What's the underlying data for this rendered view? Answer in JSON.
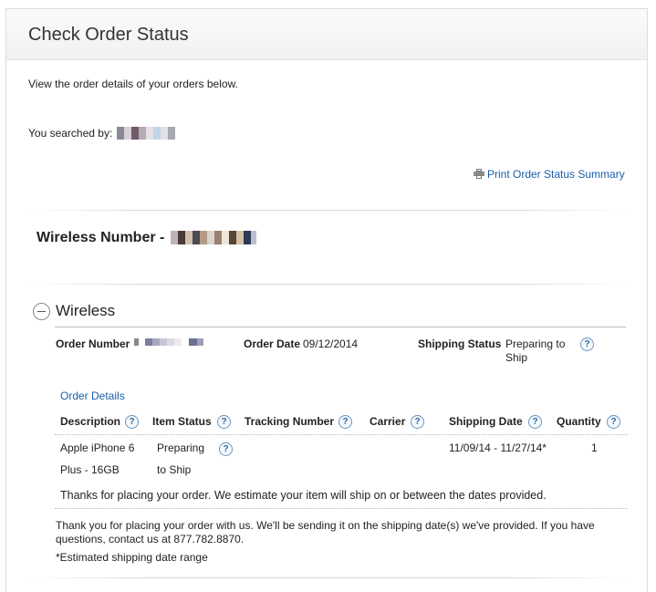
{
  "page": {
    "title": "Check Order Status",
    "intro": "View the order details of your orders below.",
    "searched_by_label": "You searched by:",
    "print_link": "Print Order Status Summary"
  },
  "wireless_number": {
    "label": "Wireless Number -"
  },
  "section": {
    "title": "Wireless"
  },
  "order": {
    "number_label": "Order Number",
    "date_label": "Order Date",
    "date_value": "09/12/2014",
    "shipping_status_label": "Shipping Status",
    "shipping_status_value": "Preparing to Ship"
  },
  "details": {
    "link": "Order Details",
    "columns": [
      "Description",
      "Item Status",
      "Tracking Number",
      "Carrier",
      "Shipping Date",
      "Quantity"
    ],
    "row": {
      "description_line1": "Apple iPhone 6",
      "description_line2": "Plus - 16GB",
      "status_line1": "Preparing",
      "status_line2": "to Ship",
      "tracking": "",
      "carrier": "",
      "shipping_date": "11/09/14 - 11/27/14*",
      "quantity": "1"
    },
    "note": "Thanks for placing your order. We estimate your item will ship on or between the dates provided."
  },
  "footer": {
    "message": "Thank you for placing your order with us. We'll be sending it on the shipping date(s) we've provided. If you have questions, contact us at 877.782.8870.",
    "footnote": "*Estimated shipping date range"
  },
  "icons": {
    "help": "question-mark-icon",
    "collapse": "minus-circle-icon",
    "print": "printer-icon",
    "help_glyph": "?"
  },
  "colors": {
    "link": "#1a5ea8",
    "help_ring": "#6a95c0"
  }
}
